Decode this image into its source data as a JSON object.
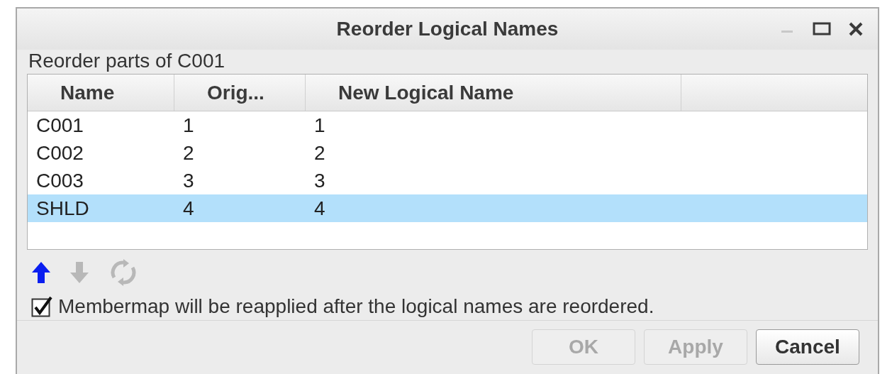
{
  "window": {
    "title": "Reorder Logical Names",
    "controls": [
      {
        "kind": "minimize",
        "disabled": true
      },
      {
        "kind": "maximize",
        "disabled": false
      },
      {
        "kind": "close",
        "disabled": false
      }
    ]
  },
  "subtitle": "Reorder parts of C001",
  "table": {
    "columns": [
      "Name",
      "Orig...",
      "New Logical Name"
    ],
    "rows": [
      {
        "cells": [
          "C001",
          "1",
          "1"
        ],
        "selected": false
      },
      {
        "cells": [
          "C002",
          "2",
          "2"
        ],
        "selected": false
      },
      {
        "cells": [
          "C003",
          "3",
          "3"
        ],
        "selected": false
      },
      {
        "cells": [
          "SHLD",
          "4",
          "4"
        ],
        "selected": true
      }
    ]
  },
  "tools": [
    {
      "kind": "up",
      "disabled": false
    },
    {
      "kind": "down",
      "disabled": true
    },
    {
      "kind": "refresh",
      "disabled": true
    }
  ],
  "checkbox": {
    "label": "Membermap will be reapplied after the logical names are reordered.",
    "checked": true
  },
  "buttons": [
    {
      "label": "OK",
      "disabled": true
    },
    {
      "label": "Apply",
      "disabled": true
    },
    {
      "label": "Cancel",
      "disabled": false
    }
  ]
}
